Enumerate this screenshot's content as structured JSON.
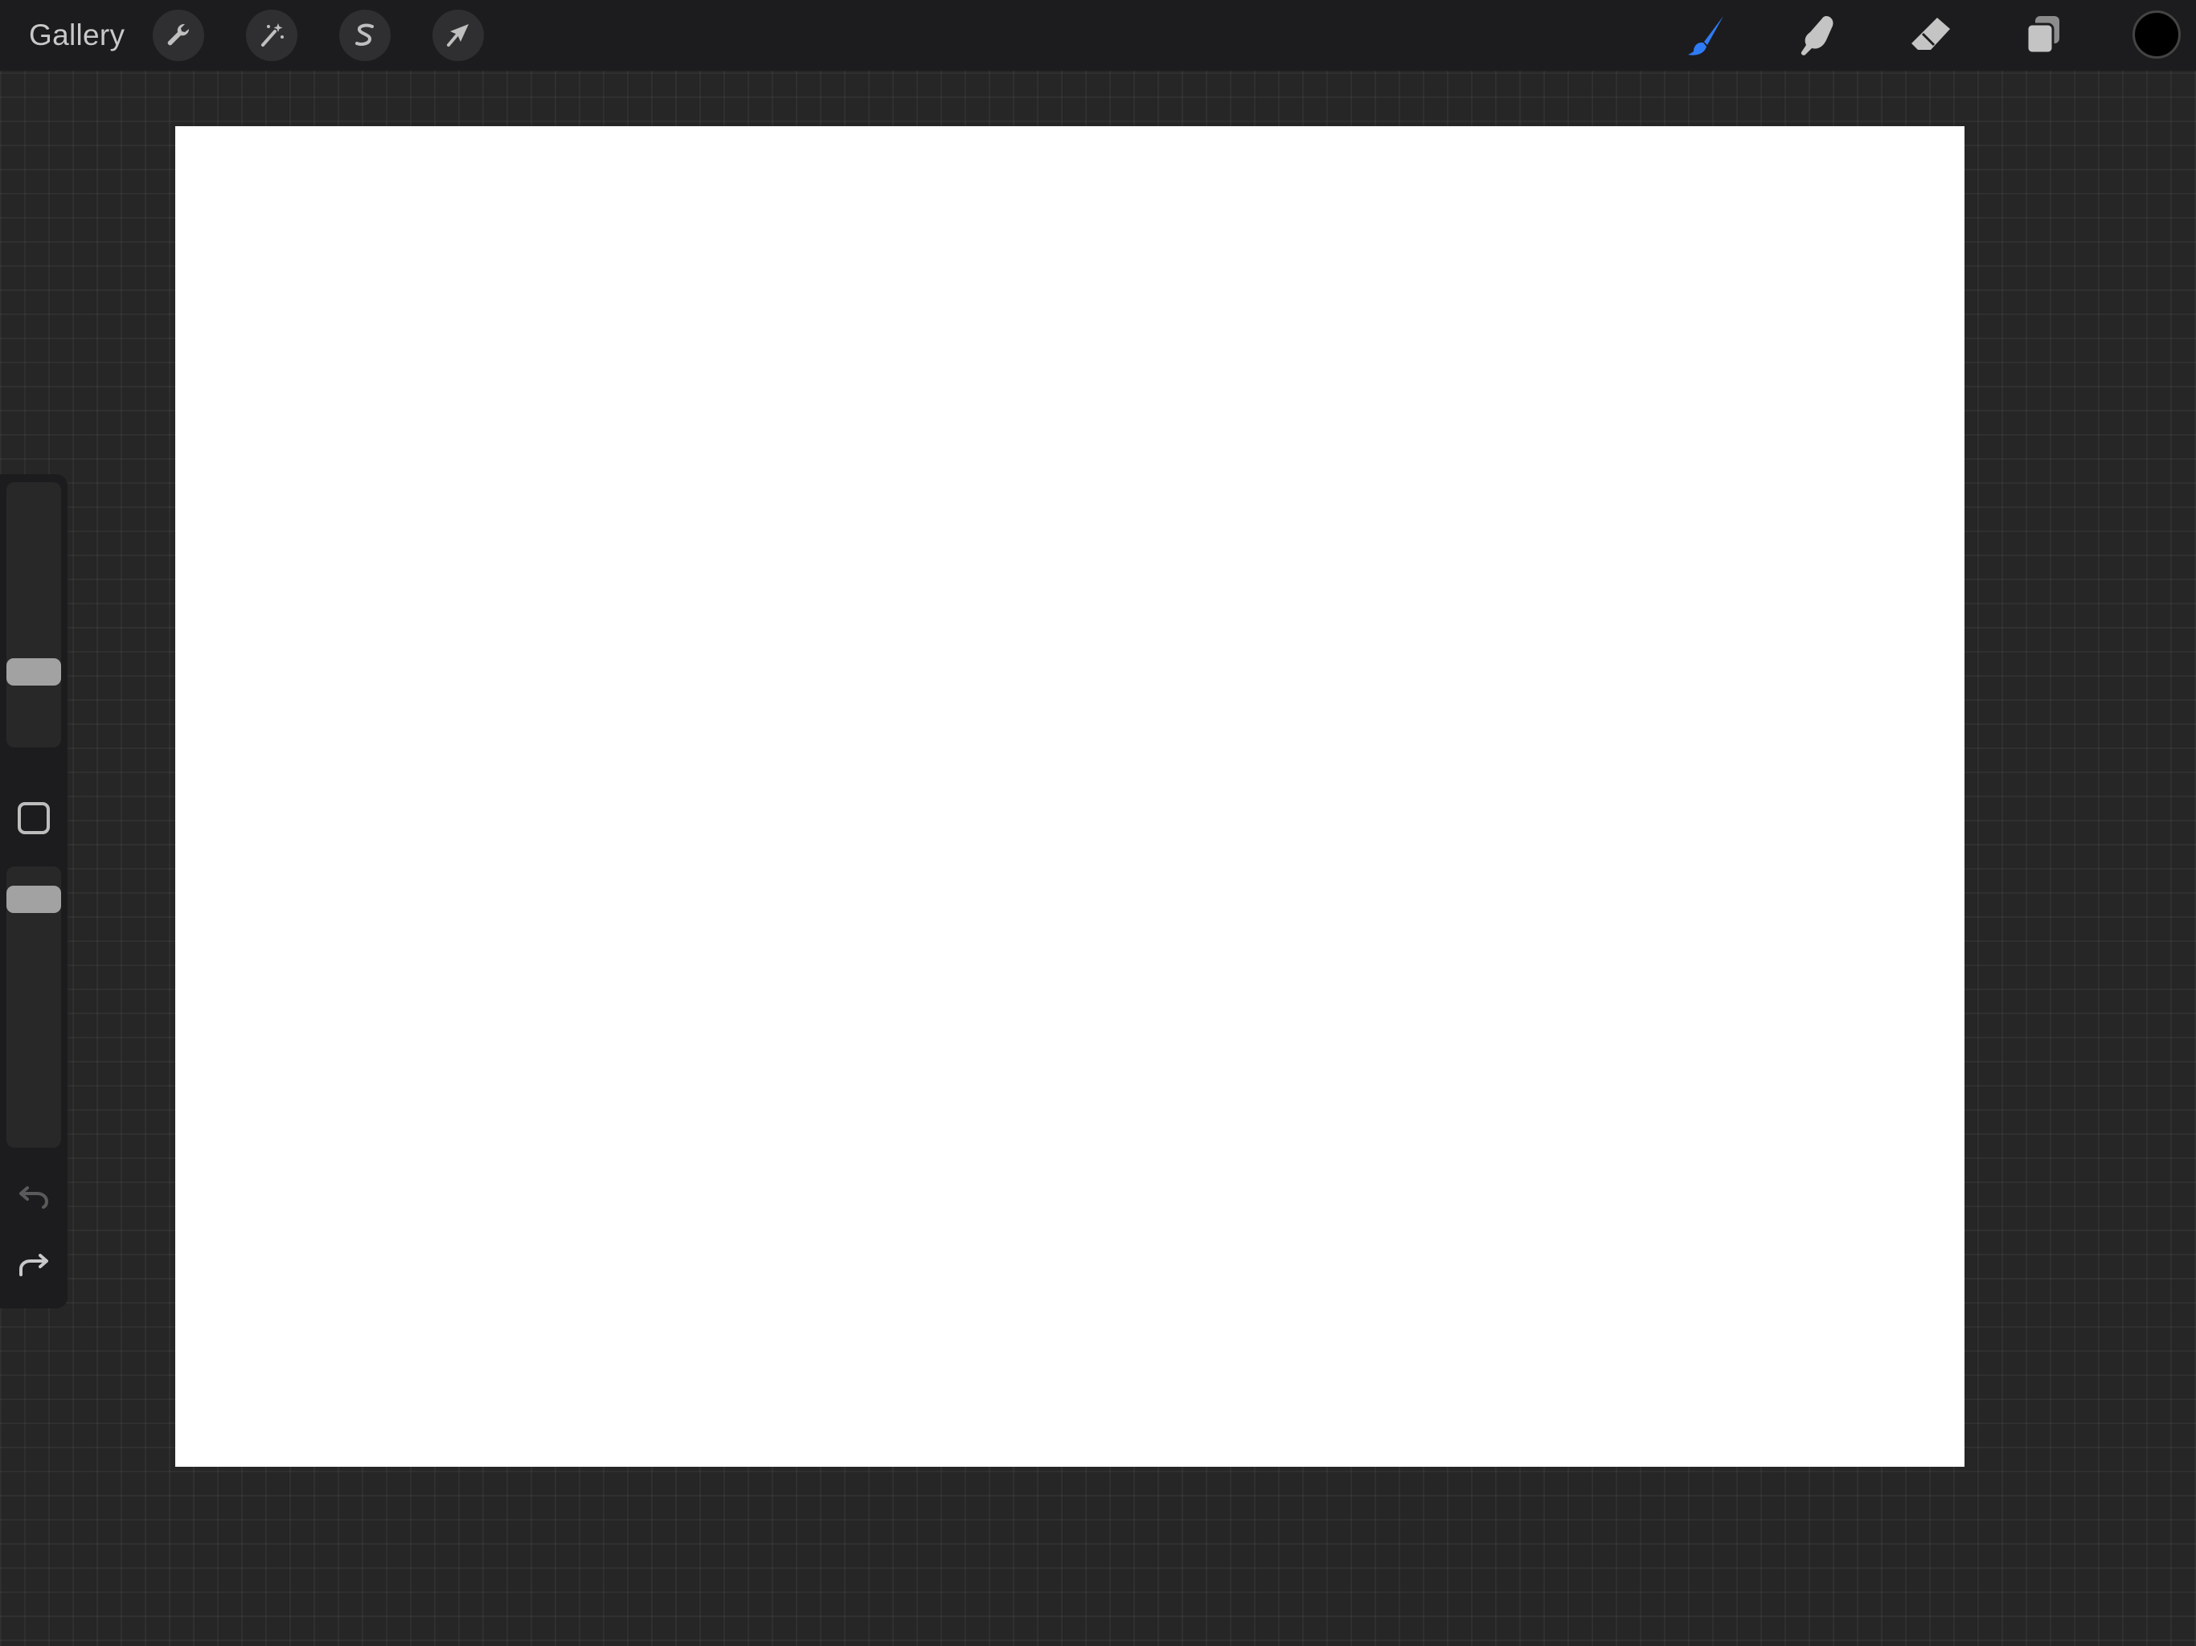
{
  "topbar": {
    "gallery_label": "Gallery",
    "left_tools": [
      {
        "name": "actions",
        "icon": "wrench-icon"
      },
      {
        "name": "adjustments",
        "icon": "magic-wand-icon"
      },
      {
        "name": "selection",
        "icon": "selection-s-icon"
      },
      {
        "name": "transform",
        "icon": "arrow-cursor-icon"
      }
    ],
    "right_tools": [
      {
        "name": "brush",
        "icon": "brush-icon",
        "active": true
      },
      {
        "name": "smudge",
        "icon": "smudge-finger-icon",
        "active": false
      },
      {
        "name": "eraser",
        "icon": "eraser-icon",
        "active": false
      },
      {
        "name": "layers",
        "icon": "layers-icon",
        "active": false
      }
    ],
    "current_color": "#000000"
  },
  "colors": {
    "active_tool": "#2f7bf5",
    "toolbar_bg": "#1c1c1e",
    "canvas_bg": "#ffffff",
    "workspace_bg": "#262626"
  },
  "sidebar": {
    "brush_size": 0.26,
    "brush_opacity": 1.0,
    "modify_icon": "square-icon",
    "undo_icon": "undo-arrow-icon",
    "redo_icon": "redo-arrow-icon"
  }
}
